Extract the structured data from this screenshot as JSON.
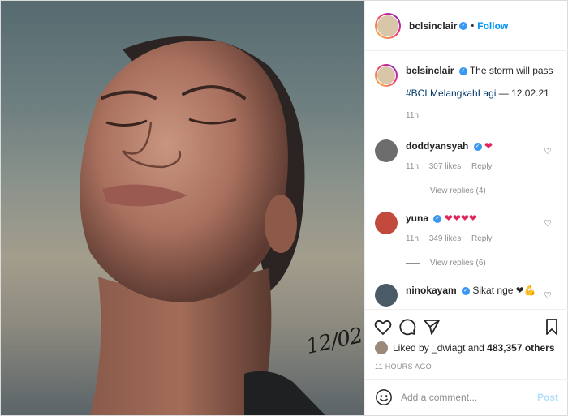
{
  "photo": {
    "signature": "12/02"
  },
  "header": {
    "username": "bclsinclair",
    "verified_icon": "check-badge-icon",
    "follow_label": "Follow",
    "separator": "•"
  },
  "caption": {
    "username": "bclsinclair",
    "text": "The storm will pass",
    "hashtag": "#BCLMelangkahLagi",
    "suffix": "— 12.02.21",
    "time": "11h"
  },
  "comments": [
    {
      "username": "doddyansyah",
      "text": "❤",
      "time": "11h",
      "likes": "307 likes",
      "reply_label": "Reply",
      "view_replies": "View replies (4)"
    },
    {
      "username": "yuna",
      "text": "❤❤❤❤",
      "time": "11h",
      "likes": "349 likes",
      "reply_label": "Reply",
      "view_replies": "View replies (6)"
    },
    {
      "username": "ninokayam",
      "text": "Sikat nge ❤💪"
    }
  ],
  "likes": {
    "prefix": "Liked by",
    "user": "_dwiagt",
    "and": "and",
    "count": "483,357 others"
  },
  "timestamp": "11 HOURS AGO",
  "add_comment": {
    "placeholder": "Add a comment...",
    "post_label": "Post"
  },
  "colors": {
    "accent": "#0095f6",
    "verified": "#3897f0",
    "heart": "#e0245e"
  }
}
